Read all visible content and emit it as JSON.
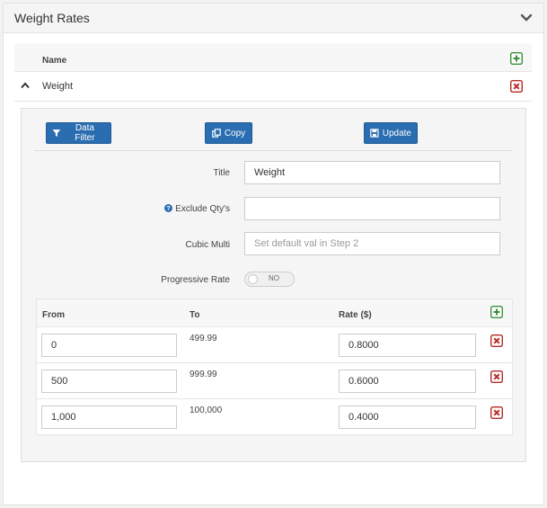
{
  "panel": {
    "title": "Weight Rates"
  },
  "list": {
    "header_name": "Name",
    "rows": [
      {
        "name": "Weight"
      }
    ]
  },
  "toolbar": {
    "filter_label": "Data Filter",
    "copy_label": "Copy",
    "update_label": "Update"
  },
  "form": {
    "title_label": "Title",
    "title_value": "Weight",
    "exclude_label": "Exclude Qty's",
    "exclude_value": "",
    "cubic_label": "Cubic Multi",
    "cubic_placeholder": "Set default val in Step 2",
    "progressive_label": "Progressive Rate",
    "progressive_state": "NO"
  },
  "rates": {
    "headers": {
      "from": "From",
      "to": "To",
      "rate": "Rate ($)"
    },
    "rows": [
      {
        "from": "0",
        "to": "499.99",
        "rate": "0.8000"
      },
      {
        "from": "500",
        "to": "999.99",
        "rate": "0.6000"
      },
      {
        "from": "1,000",
        "to": "100,000",
        "rate": "0.4000"
      }
    ]
  },
  "colors": {
    "primary": "#2a6db0",
    "add_green": "#3c8f3c",
    "delete_red": "#b52b27"
  },
  "icons": {
    "collapse": "chevron-down-icon",
    "row_toggle": "chevron-up-icon",
    "add": "plus-square-icon",
    "delete": "close-square-icon",
    "filter": "filter-icon",
    "copy": "copy-icon",
    "update": "save-icon",
    "help": "question-circle-icon"
  }
}
